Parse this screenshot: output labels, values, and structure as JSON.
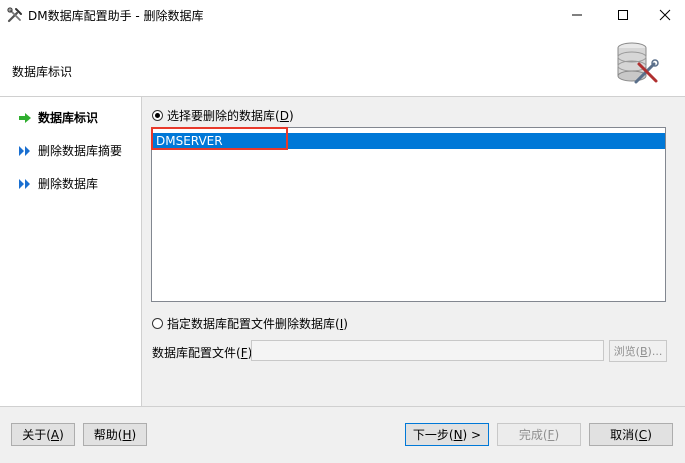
{
  "window": {
    "title": "DM数据库配置助手 - 删除数据库",
    "controls": [
      "minimize",
      "maximize",
      "close"
    ]
  },
  "header": {
    "label": "数据库标识",
    "logo_icon": "database-tools-icon"
  },
  "nav": {
    "items": [
      {
        "label": "数据库标识",
        "icon": "green-arrow-icon",
        "active": true
      },
      {
        "label": "删除数据库摘要",
        "icon": "blue-double-chevron-icon",
        "active": false
      },
      {
        "label": "删除数据库",
        "icon": "blue-double-chevron-icon",
        "active": false
      }
    ]
  },
  "content": {
    "radio_select_db": {
      "label": "选择要删除的数据库(",
      "hotkey": "D",
      "suffix": ")",
      "checked": true
    },
    "db_list": {
      "items": [
        "DMSERVER"
      ],
      "selected_index": 0
    },
    "radio_config_file": {
      "label": "指定数据库配置文件删除数据库(",
      "hotkey": "I",
      "suffix": ")",
      "checked": false
    },
    "config_file": {
      "label": "数据库配置文件(",
      "hotkey": "F",
      "suffix": "):",
      "value": ""
    },
    "browse_button": {
      "label": "浏览(",
      "hotkey": "B",
      "suffix": ")...",
      "enabled": false
    }
  },
  "footer": {
    "about": {
      "label": "关于(",
      "hotkey": "A",
      "suffix": ")"
    },
    "help": {
      "label": "帮助(",
      "hotkey": "H",
      "suffix": ")"
    },
    "next": {
      "label": "下一步(",
      "hotkey": "N",
      "suffix": ") >"
    },
    "finish": {
      "label": "完成(",
      "hotkey": "F",
      "suffix": ")",
      "enabled": false
    },
    "cancel": {
      "label": "取消(",
      "hotkey": "C",
      "suffix": ")"
    }
  },
  "colors": {
    "selection": "#0078d7",
    "highlight_annotation": "#e8392b",
    "nav_arrow_green": "#2fae2f",
    "nav_chevron_blue": "#1a6fd0"
  }
}
